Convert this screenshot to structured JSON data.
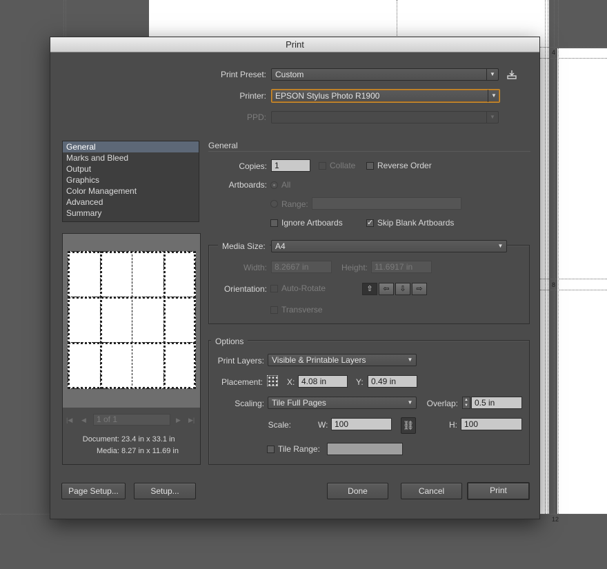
{
  "dialog": {
    "title": "Print"
  },
  "canvas": {
    "page_numbers": [
      "4",
      "8",
      "12"
    ]
  },
  "preset": {
    "label": "Print Preset:",
    "value": "Custom"
  },
  "printer": {
    "label": "Printer:",
    "value": "EPSON Stylus Photo R1900"
  },
  "ppd": {
    "label": "PPD:",
    "value": ""
  },
  "sidebar": {
    "items": [
      {
        "label": "General",
        "selected": true
      },
      {
        "label": "Marks and Bleed"
      },
      {
        "label": "Output"
      },
      {
        "label": "Graphics"
      },
      {
        "label": "Color Management"
      },
      {
        "label": "Advanced"
      },
      {
        "label": "Summary"
      }
    ]
  },
  "general": {
    "section_title": "General",
    "copies_label": "Copies:",
    "copies_value": "1",
    "collate_label": "Collate",
    "reverse_order_label": "Reverse Order",
    "artboards_label": "Artboards:",
    "all_label": "All",
    "range_label": "Range:",
    "range_value": "",
    "ignore_artboards_label": "Ignore Artboards",
    "skip_blank_label": "Skip Blank Artboards",
    "skip_blank_checked": true
  },
  "media": {
    "size_label": "Media Size:",
    "size_value": "A4",
    "width_label": "Width:",
    "width_value": "8.2667 in",
    "height_label": "Height:",
    "height_value": "11.6917 in",
    "orientation_label": "Orientation:",
    "auto_rotate_label": "Auto-Rotate",
    "transverse_label": "Transverse"
  },
  "options": {
    "title": "Options",
    "print_layers_label": "Print Layers:",
    "print_layers_value": "Visible & Printable Layers",
    "placement_label": "Placement:",
    "x_label": "X:",
    "x_value": "4.08 in",
    "y_label": "Y:",
    "y_value": "0.49 in",
    "scaling_label": "Scaling:",
    "scaling_value": "Tile Full Pages",
    "overlap_label": "Overlap:",
    "overlap_value": "0.5 in",
    "scale_label": "Scale:",
    "w_label": "W:",
    "w_value": "100",
    "h_label": "H:",
    "h_value": "100",
    "tile_range_label": "Tile Range:",
    "tile_range_value": ""
  },
  "preview": {
    "page_field": "1 of 1",
    "document_label": "Document:",
    "document_value": "23.4 in x 33.1 in",
    "media_label": "Media:",
    "media_value": "8.27 in x 11.69 in"
  },
  "buttons": {
    "page_setup": "Page Setup...",
    "setup": "Setup...",
    "done": "Done",
    "cancel": "Cancel",
    "print": "Print"
  },
  "colors": {
    "dialog_bg": "#4b4b4b",
    "focus_ring": "#d1902c",
    "selection": "#5d6877"
  }
}
